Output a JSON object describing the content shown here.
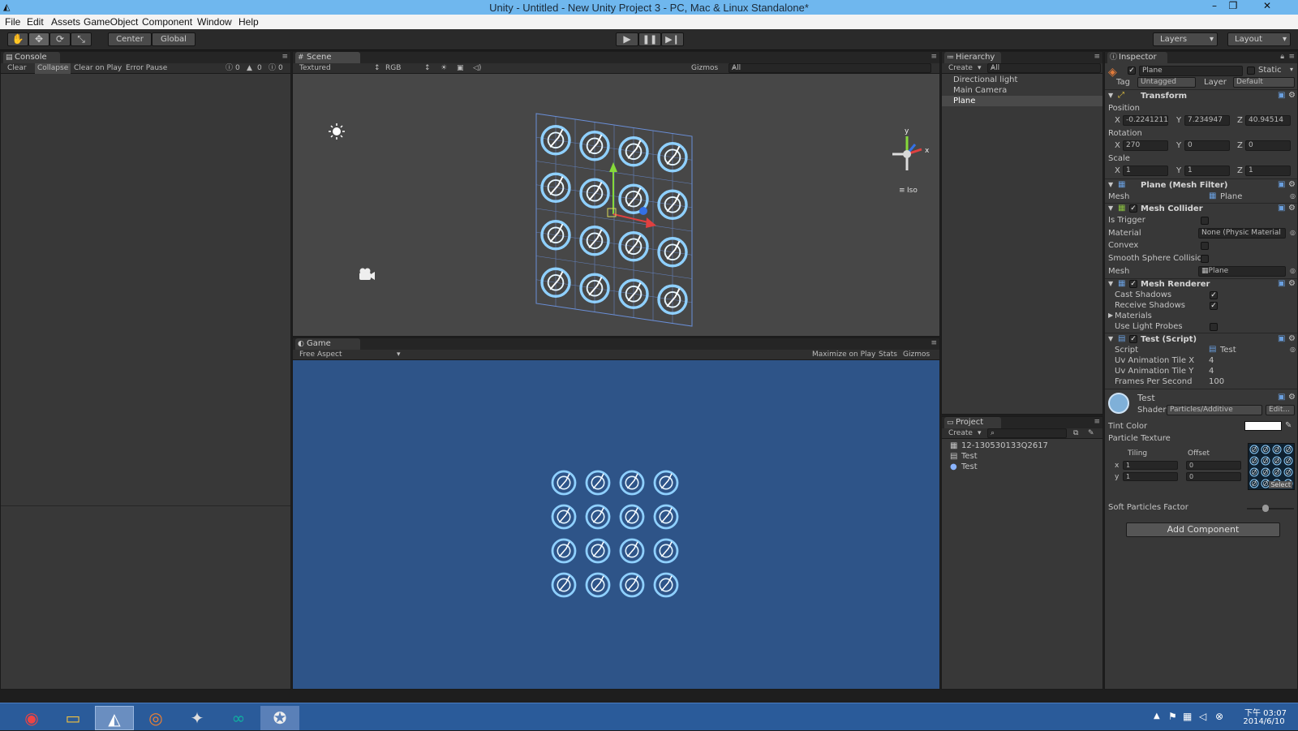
{
  "window": {
    "title": "Unity - Untitled - New Unity Project 3 - PC, Mac & Linux Standalone*"
  },
  "menu": [
    "File",
    "Edit",
    "Assets",
    "GameObject",
    "Component",
    "Window",
    "Help"
  ],
  "toolbar": {
    "center": "Center",
    "global": "Global",
    "layers": "Layers",
    "layout": "Layout"
  },
  "console": {
    "tab": "Console",
    "buttons": [
      "Clear",
      "Collapse",
      "Clear on Play",
      "Error Pause"
    ],
    "counts": [
      "0",
      "0",
      "0"
    ]
  },
  "scene": {
    "tab": "Scene",
    "mode": "Textured",
    "rgb": "RGB",
    "gizmos": "Gizmos",
    "search": "All",
    "iso": "Iso",
    "axis_y": "y",
    "axis_x": "x"
  },
  "game": {
    "tab": "Game",
    "aspect": "Free Aspect",
    "maximize": "Maximize on Play",
    "stats": "Stats",
    "gizmos": "Gizmos"
  },
  "hierarchy": {
    "tab": "Hierarchy",
    "create": "Create",
    "search": "All",
    "items": [
      "Directional light",
      "Main Camera",
      "Plane"
    ],
    "selected": 2
  },
  "project": {
    "tab": "Project",
    "create": "Create",
    "items": [
      "12-130530133Q2617",
      "Test",
      "Test"
    ]
  },
  "inspector": {
    "tab": "Inspector",
    "object": "Plane",
    "static": "Static",
    "tag_label": "Tag",
    "tag": "Untagged",
    "layer_label": "Layer",
    "layer": "Default",
    "transform": {
      "title": "Transform",
      "position_label": "Position",
      "rotation_label": "Rotation",
      "scale_label": "Scale",
      "position": [
        "-0.2241211",
        "7.234947",
        "40.94514"
      ],
      "rotation": [
        "270",
        "0",
        "0"
      ],
      "scale": [
        "1",
        "1",
        "1"
      ],
      "axes": [
        "X",
        "Y",
        "Z"
      ]
    },
    "mesh_filter": {
      "title": "Plane (Mesh Filter)",
      "mesh_label": "Mesh",
      "mesh": "Plane"
    },
    "mesh_collider": {
      "title": "Mesh Collider",
      "is_trigger": "Is Trigger",
      "material_label": "Material",
      "material": "None (Physic Material",
      "convex": "Convex",
      "smooth": "Smooth Sphere Collisio",
      "mesh_label": "Mesh",
      "mesh": "Plane"
    },
    "mesh_renderer": {
      "title": "Mesh Renderer",
      "cast": "Cast Shadows",
      "receive": "Receive Shadows",
      "materials": "Materials",
      "probes": "Use Light Probes"
    },
    "script": {
      "title": "Test (Script)",
      "script_label": "Script",
      "script": "Test",
      "tile_x_label": "Uv Animation Tile X",
      "tile_x": "4",
      "tile_y_label": "Uv Animation Tile Y",
      "tile_y": "4",
      "fps_label": "Frames Per Second",
      "fps": "100"
    },
    "material": {
      "name": "Test",
      "shader_label": "Shader",
      "shader": "Particles/Additive",
      "edit": "Edit...",
      "tint": "Tint Color",
      "texture": "Particle Texture",
      "tiling": "Tiling",
      "offset": "Offset",
      "x": "x",
      "y": "y",
      "tile_x": "1",
      "tile_y": "1",
      "off_x": "0",
      "off_y": "0",
      "select": "Select",
      "soft": "Soft Particles Factor"
    },
    "add_component": "Add Component"
  },
  "taskbar": {
    "time": "下午 03:07",
    "date": "2014/6/10"
  },
  "colors": {
    "title_bar": "#6fb7ee",
    "panel": "#383838",
    "game_bg": "#2e5488",
    "scene_bg": "#474747",
    "taskbar": "#2a5b9a"
  }
}
